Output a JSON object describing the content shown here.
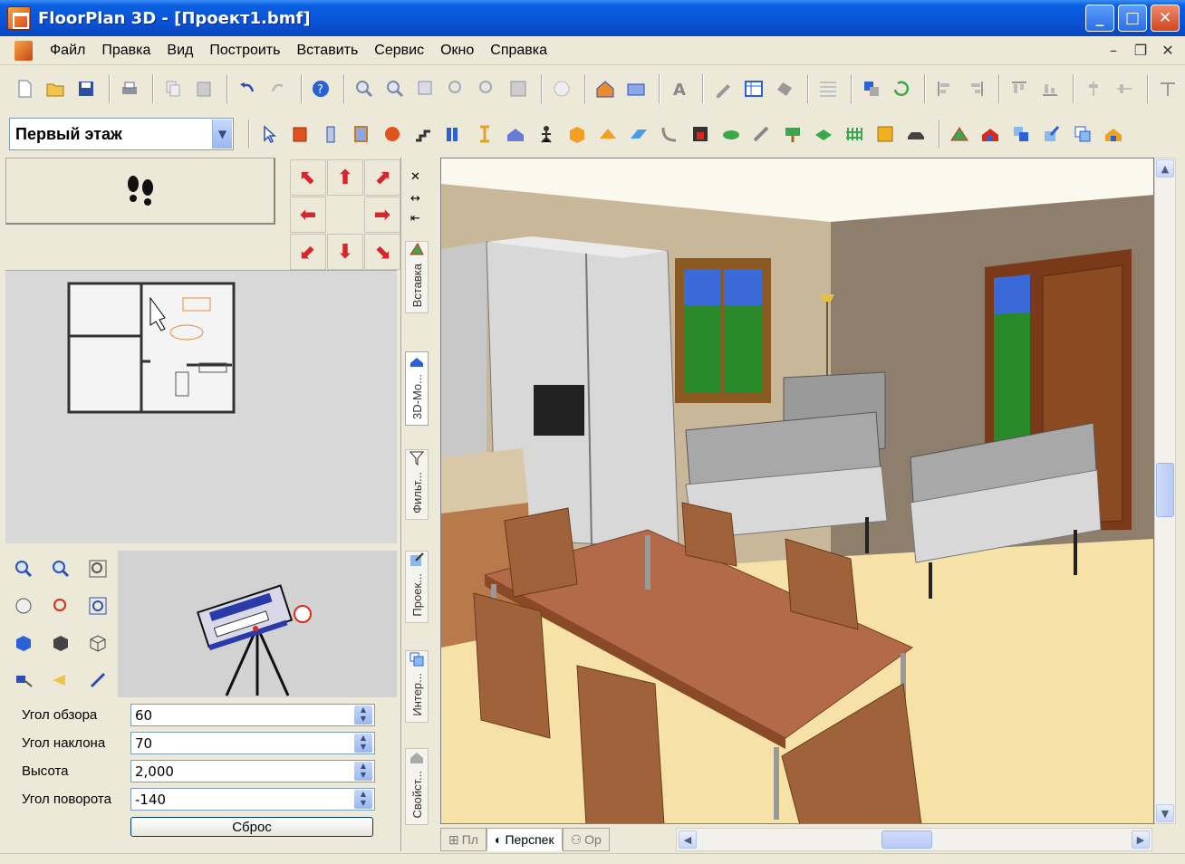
{
  "window": {
    "title": "FloorPlan 3D - [Проект1.bmf]"
  },
  "menu": [
    "Файл",
    "Правка",
    "Вид",
    "Построить",
    "Вставить",
    "Сервис",
    "Окно",
    "Справка"
  ],
  "floor_select": {
    "value": "Первый этаж"
  },
  "camera_props": {
    "fov": {
      "label": "Угол обзора",
      "value": "60"
    },
    "tilt": {
      "label": "Угол наклона",
      "value": "70"
    },
    "height": {
      "label": "Высота",
      "value": "2,000"
    },
    "rotation": {
      "label": "Угол поворота",
      "value": "-140"
    },
    "reset_label": "Сброс"
  },
  "side_tabs": [
    "Вставка",
    "3D-Мо...",
    "Фильт...",
    "Проек...",
    "Интер...",
    "Свойст..."
  ],
  "view_tabs": [
    "Пл",
    "Перспек",
    "Ор"
  ],
  "colors": {
    "title_blue": "#0b53d6",
    "accent_red": "#d7262b"
  }
}
